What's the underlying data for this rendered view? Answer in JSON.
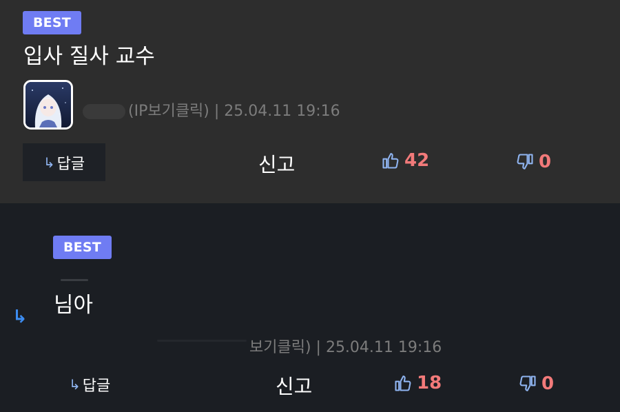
{
  "comments": [
    {
      "badge": "BEST",
      "text": "입사 질사 교수",
      "meta": "(IP보기클릭) | 25.04.11 19:16",
      "reply_label": "답글",
      "report_label": "신고",
      "likes": "42",
      "dislikes": "0"
    },
    {
      "badge": "BEST",
      "text": "님아",
      "meta": "보기클릭) | 25.04.11 19:16",
      "reply_label": "답글",
      "report_label": "신고",
      "likes": "18",
      "dislikes": "0"
    }
  ],
  "colors": {
    "badge": "#6f7cf3",
    "count": "#f27a7a",
    "icon": "#8fb4f0",
    "first_bg": "#2d2d2d",
    "second_bg": "#1b1e23"
  }
}
